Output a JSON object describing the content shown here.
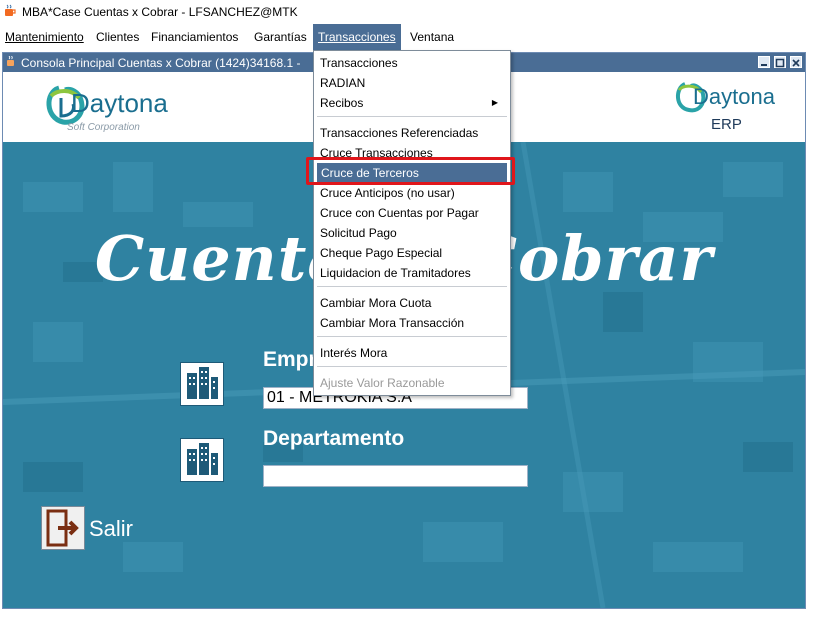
{
  "window": {
    "title": "MBA*Case Cuentas x Cobrar - LFSANCHEZ@MTK"
  },
  "menubar": {
    "items": [
      "Mantenimiento",
      "Clientes",
      "Financiamientos",
      "Garantías",
      "Transacciones",
      "Ventana"
    ],
    "active": "Transacciones"
  },
  "inner_window": {
    "title": "Consola Principal Cuentas x Cobrar (1424)34168.1 -"
  },
  "logos": {
    "left": {
      "name": "Daytona",
      "sub": "Soft Corporation"
    },
    "right": {
      "name": "Daytona",
      "sub": "ERP"
    }
  },
  "main": {
    "big_title": "Cuentas x Cobrar",
    "empresa_label": "Empresa",
    "empresa_value": "01 - METROKIA S.A",
    "departamento_label": "Departamento",
    "departamento_value": "",
    "salir_label": "Salir"
  },
  "menu": {
    "items": [
      {
        "label": "Transacciones"
      },
      {
        "label": "RADIAN"
      },
      {
        "label": "Recibos",
        "submenu": true
      },
      {
        "label": "Transacciones Referenciadas"
      },
      {
        "label": "Cruce Transacciones"
      },
      {
        "label": "Cruce de Terceros",
        "selected": true
      },
      {
        "label": "Cruce Anticipos (no usar)"
      },
      {
        "label": "Cruce con Cuentas por Pagar"
      },
      {
        "label": "Solicitud Pago"
      },
      {
        "label": "Cheque Pago Especial"
      },
      {
        "label": "Liquidacion de Tramitadores"
      },
      {
        "label": "Cambiar Mora Cuota"
      },
      {
        "label": "Cambiar Mora Transacción"
      },
      {
        "label": "Interés Mora"
      },
      {
        "label": "Ajuste Valor Razonable",
        "disabled": true
      }
    ]
  },
  "colors": {
    "accent": "#4a6d95",
    "banner": "#2d7f9e",
    "highlight": "#e0161b"
  }
}
